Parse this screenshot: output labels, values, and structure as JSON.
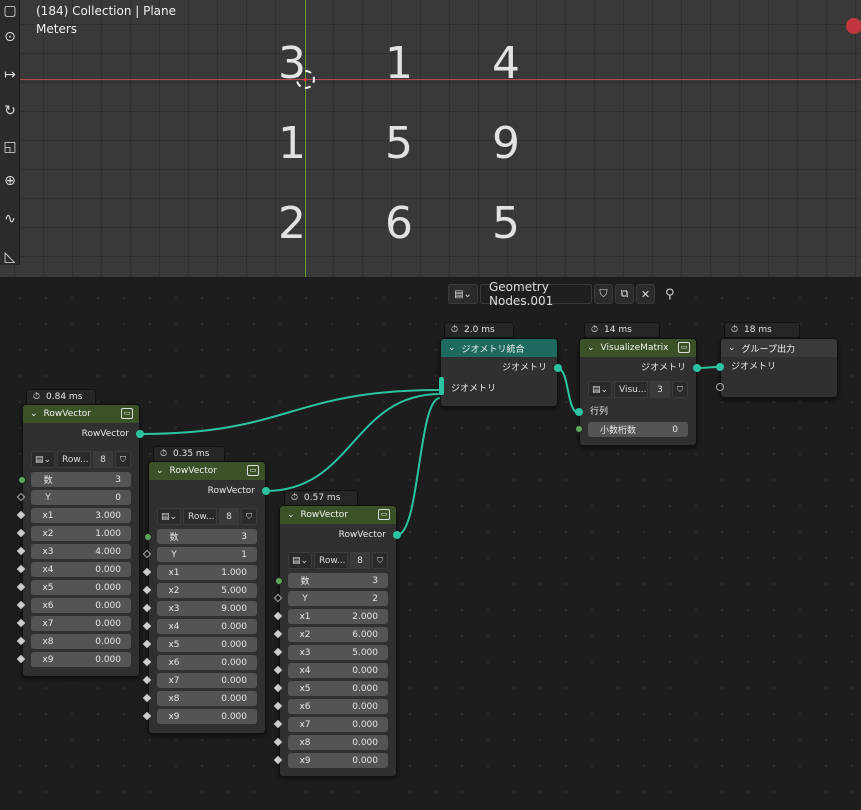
{
  "viewport": {
    "title": "(184) Collection | Plane",
    "unit": "Meters",
    "matrix": [
      [
        "3",
        "1",
        "4"
      ],
      [
        "1",
        "5",
        "9"
      ],
      [
        "2",
        "6",
        "5"
      ]
    ]
  },
  "editor_header": {
    "tree_name": "Geometry Nodes.001"
  },
  "nodes": {
    "rv1": {
      "time": "0.84 ms",
      "title": "RowVector",
      "output": "RowVector",
      "select": "Row...",
      "select_num": "8",
      "rows": [
        {
          "label": "数",
          "value": "3"
        },
        {
          "label": "Y",
          "value": "0"
        },
        {
          "label": "x1",
          "value": "3.000"
        },
        {
          "label": "x2",
          "value": "1.000"
        },
        {
          "label": "x3",
          "value": "4.000"
        },
        {
          "label": "x4",
          "value": "0.000"
        },
        {
          "label": "x5",
          "value": "0.000"
        },
        {
          "label": "x6",
          "value": "0.000"
        },
        {
          "label": "x7",
          "value": "0.000"
        },
        {
          "label": "x8",
          "value": "0.000"
        },
        {
          "label": "x9",
          "value": "0.000"
        }
      ]
    },
    "rv2": {
      "time": "0.35 ms",
      "title": "RowVector",
      "output": "RowVector",
      "select": "Row...",
      "select_num": "8",
      "rows": [
        {
          "label": "数",
          "value": "3"
        },
        {
          "label": "Y",
          "value": "1"
        },
        {
          "label": "x1",
          "value": "1.000"
        },
        {
          "label": "x2",
          "value": "5.000"
        },
        {
          "label": "x3",
          "value": "9.000"
        },
        {
          "label": "x4",
          "value": "0.000"
        },
        {
          "label": "x5",
          "value": "0.000"
        },
        {
          "label": "x6",
          "value": "0.000"
        },
        {
          "label": "x7",
          "value": "0.000"
        },
        {
          "label": "x8",
          "value": "0.000"
        },
        {
          "label": "x9",
          "value": "0.000"
        }
      ]
    },
    "rv3": {
      "time": "0.57 ms",
      "title": "RowVector",
      "output": "RowVector",
      "select": "Row...",
      "select_num": "8",
      "rows": [
        {
          "label": "数",
          "value": "3"
        },
        {
          "label": "Y",
          "value": "2"
        },
        {
          "label": "x1",
          "value": "2.000"
        },
        {
          "label": "x2",
          "value": "6.000"
        },
        {
          "label": "x3",
          "value": "5.000"
        },
        {
          "label": "x4",
          "value": "0.000"
        },
        {
          "label": "x5",
          "value": "0.000"
        },
        {
          "label": "x6",
          "value": "0.000"
        },
        {
          "label": "x7",
          "value": "0.000"
        },
        {
          "label": "x8",
          "value": "0.000"
        },
        {
          "label": "x9",
          "value": "0.000"
        }
      ]
    },
    "join": {
      "time": "2.0 ms",
      "title": "ジオメトリ統合",
      "output": "ジオメトリ",
      "input": "ジオメトリ"
    },
    "viz": {
      "time": "14 ms",
      "title": "VisualizeMatrix",
      "output": "ジオメトリ",
      "select": "Visu...",
      "select_num": "3",
      "input_matrix": "行列",
      "decimals_label": "小数桁数",
      "decimals_value": "0"
    },
    "group_out": {
      "time": "18 ms",
      "title": "グループ出力",
      "input": "ジオメトリ"
    }
  },
  "colors": {
    "link": "#2cc4a0",
    "node_header_green": "#3b5228",
    "node_header_teal": "#1f6a5e",
    "x_axis": "#b24a55",
    "y_axis": "#6ba53a"
  }
}
